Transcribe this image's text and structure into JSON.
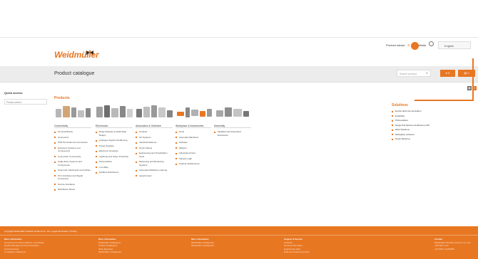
{
  "brand": {
    "name": "Weidmüller",
    "color": "#e87722"
  },
  "toplinks": {
    "product_wizard": "Product wizard",
    "website": "Website",
    "language": "English"
  },
  "page_title": "Product catalogue",
  "search": {
    "placeholder": "Search product"
  },
  "header_buttons": {
    "cart": "0",
    "notes": "0"
  },
  "quick": {
    "label": "Quick access",
    "placeholder": "Please select"
  },
  "products_title": "Products",
  "solutions": {
    "title": "Solutions",
    "items": [
      "Device field communication",
      "E-Mobility",
      "Photovoltaics",
      "Single Pair Ethernet & Ethernet-APL",
      "Wind Solutions",
      "Workplace solutions",
      "Smart Metering"
    ]
  },
  "categories": [
    {
      "title": "Connectivity",
      "items": [
        "Terminal Blocks",
        "Connectors",
        "PCB Terminals and Connectors",
        "Enclosure Systems and Components",
        "Connection Connectivity",
        "Cable Entry Systems and Components",
        "Overmold, Patchcords and Cables",
        "PLC Interfaces and Signal Conversion",
        "Service Interfaces",
        "Distribution Boxes"
      ]
    },
    {
      "title": "Electronics",
      "items": [
        "Relay Modules & Solid-State Relays",
        "Analogue Signal Conditioning",
        "Power Supplies",
        "Electronic Housings",
        "Lightning and Surge Protection",
        "Photovoltaics",
        "u-mobility",
        "Fieldbus Distributors"
      ]
    },
    {
      "title": "Automation & Software",
      "items": [
        "Controls",
        "I/O Systems",
        "Industrial Ethernet",
        "Touch Panels",
        "Engineering and Visualization Tools",
        "Measuring and Monitoring Systems",
        "Automated Machine Learning",
        "easyConnect"
      ]
    },
    {
      "title": "Workplace & Accessories",
      "items": [
        "Tools",
        "Automatic Machines",
        "Software",
        "Markers",
        "Industrial printers",
        "Industry Light",
        "Cabinet infrastructure"
      ]
    },
    {
      "title": "Assembly",
      "items": [
        "Modified and Assembled Enclosures"
      ]
    }
  ],
  "footer": {
    "top": "Copyright Weidmüller Interface GmbH & Co. KG | Legal Information | Privacy",
    "cols": [
      {
        "h": "More information",
        "t": [
          "General terms and conditions of purchase",
          "Quality Management Documentation",
          "Download Area",
          "Compliance Statement"
        ]
      },
      {
        "h": "More information",
        "t": [
          "Weidmüller Catalogues",
          "Product Catalogues",
          "Work Expertise",
          "Weidmüller Configurator"
        ]
      },
      {
        "h": "More information",
        "t": [
          "Weidmüller Configurator",
          "Weidmüller Configurator"
        ]
      },
      {
        "h": "Support & Service",
        "t": [
          "Contacts",
          "General information",
          "Engineering data",
          "Data and engineering data"
        ]
      },
      {
        "h": "Contact",
        "t": [
          "Weidmüller Interface GmbH & Co. KG",
          "",
          "+49 5231 14-0",
          "+49 5231 14-292083"
        ]
      }
    ]
  }
}
